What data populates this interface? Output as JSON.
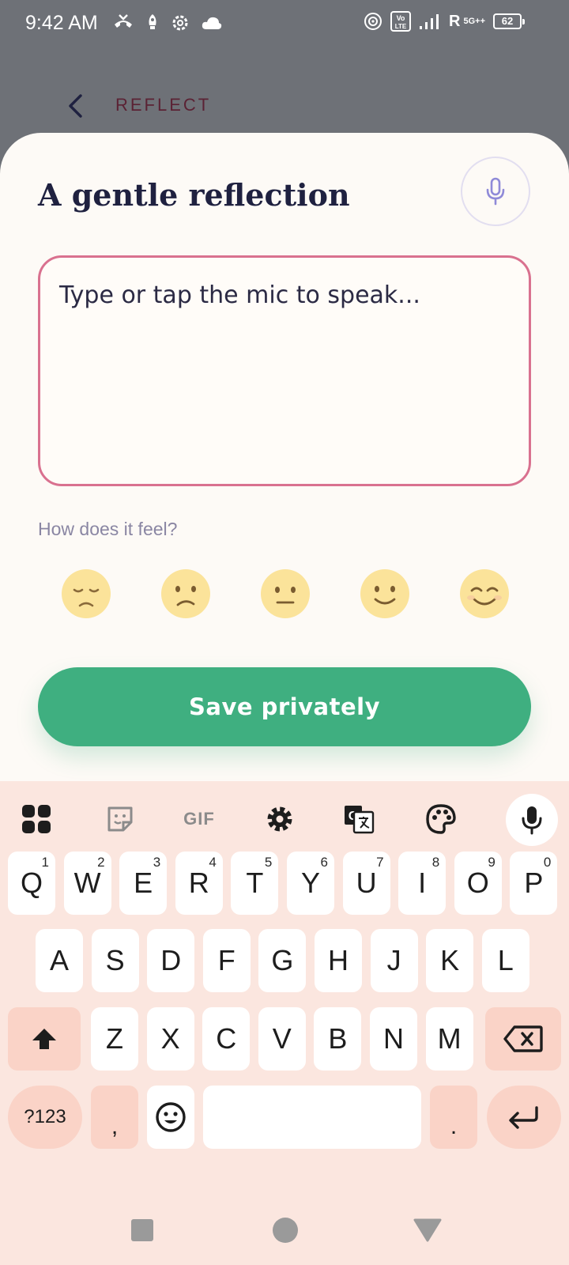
{
  "status_bar": {
    "time": "9:42 AM",
    "network_label": "R",
    "network_type": "5G++",
    "volte": "Vo LTE",
    "battery": "62"
  },
  "header": {
    "title": "REFLECT"
  },
  "sheet": {
    "title": "A gentle reflection",
    "entry_placeholder": "Type or tap the mic to speak...",
    "feel_label": "How does it feel?",
    "save_label": "Save privately",
    "moods": [
      "very-sad",
      "sad",
      "neutral",
      "happy",
      "very-happy"
    ]
  },
  "keyboard": {
    "toolbar": {
      "gif_label": "GIF"
    },
    "row1": [
      {
        "key": "Q",
        "hint": "1"
      },
      {
        "key": "W",
        "hint": "2"
      },
      {
        "key": "E",
        "hint": "3"
      },
      {
        "key": "R",
        "hint": "4"
      },
      {
        "key": "T",
        "hint": "5"
      },
      {
        "key": "Y",
        "hint": "6"
      },
      {
        "key": "U",
        "hint": "7"
      },
      {
        "key": "I",
        "hint": "8"
      },
      {
        "key": "O",
        "hint": "9"
      },
      {
        "key": "P",
        "hint": "0"
      }
    ],
    "row2": [
      "A",
      "S",
      "D",
      "F",
      "G",
      "H",
      "J",
      "K",
      "L"
    ],
    "row3": [
      "Z",
      "X",
      "C",
      "V",
      "B",
      "N",
      "M"
    ],
    "symbols_label": "?123",
    "comma_label": ",",
    "period_label": "."
  },
  "colors": {
    "accent": "#3faf80",
    "entry_border": "#d9718f",
    "title": "#1f2140",
    "header_title": "#5b2234"
  }
}
